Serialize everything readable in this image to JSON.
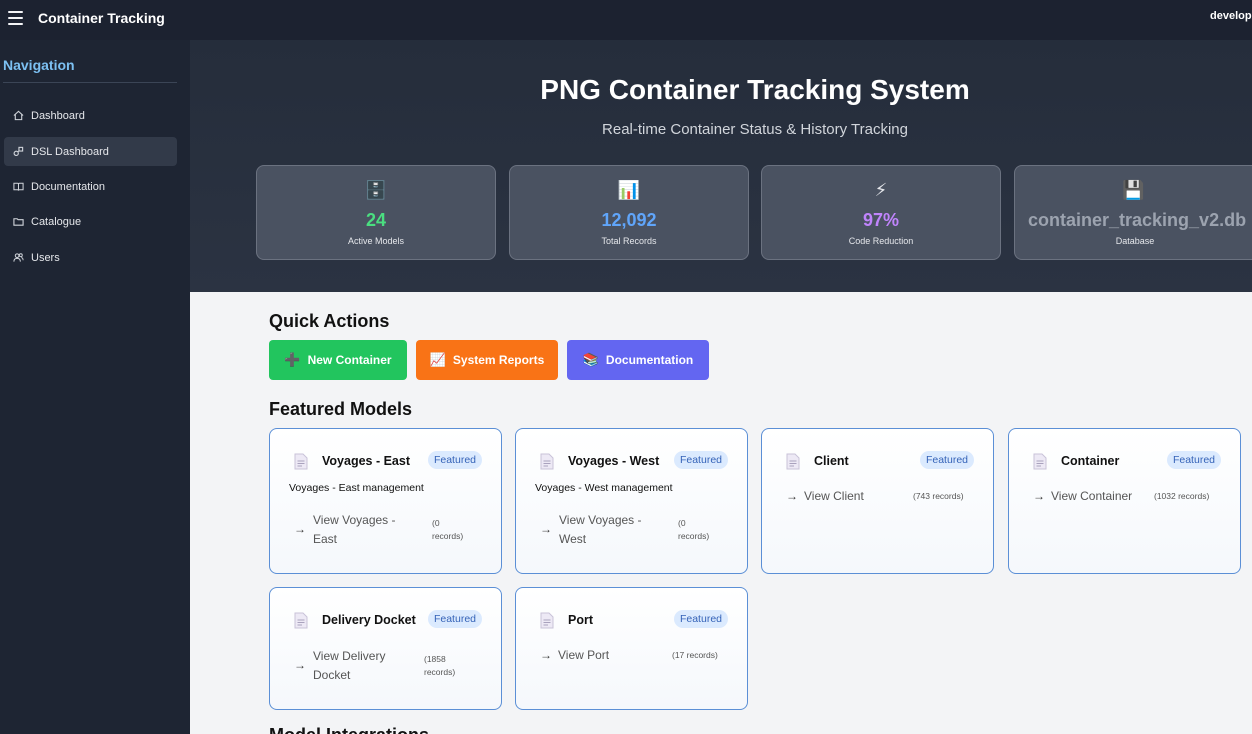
{
  "app": {
    "title": "Container Tracking",
    "user": "developer"
  },
  "sidebar": {
    "heading": "Navigation",
    "items": [
      {
        "label": "Dashboard",
        "icon": "home-icon",
        "active": false
      },
      {
        "label": "DSL Dashboard",
        "icon": "dsl-icon",
        "active": true
      },
      {
        "label": "Documentation",
        "icon": "book-icon",
        "active": false
      },
      {
        "label": "Catalogue",
        "icon": "folder-icon",
        "active": false
      },
      {
        "label": "Users",
        "icon": "users-icon",
        "active": false
      }
    ]
  },
  "hero": {
    "title": "PNG Container Tracking System",
    "subtitle": "Real-time Container Status & History Tracking",
    "stats": [
      {
        "icon": "🗄️",
        "value": "24",
        "label": "Active Models",
        "color": "#4ade80"
      },
      {
        "icon": "📊",
        "value": "12,092",
        "label": "Total Records",
        "color": "#60a5fa"
      },
      {
        "icon": "⚡",
        "value": "97%",
        "label": "Code Reduction",
        "color": "#c084fc"
      },
      {
        "icon": "💾",
        "value": "container_tracking_v2.db",
        "label": "Database",
        "color": "#9ca3af"
      }
    ]
  },
  "quick_actions": {
    "title": "Quick Actions",
    "buttons": [
      {
        "label": "New Container",
        "icon": "➕",
        "color": "#22c55e"
      },
      {
        "label": "System Reports",
        "icon": "📈",
        "color": "#f97316"
      },
      {
        "label": "Documentation",
        "icon": "📚",
        "color": "#6366f1"
      }
    ]
  },
  "featured": {
    "title": "Featured Models",
    "next_section_title": "Model Integrations",
    "cards": [
      {
        "title": "Voyages - East",
        "badge": "Featured",
        "description": "Voyages - East management",
        "link_lines": [
          "View Voyages -",
          "East"
        ],
        "count_lines": [
          "(0",
          "records)"
        ]
      },
      {
        "title": "Voyages - West",
        "badge": "Featured",
        "description": "Voyages - West management",
        "link_lines": [
          "View Voyages -",
          "West"
        ],
        "count_lines": [
          "(0",
          "records)"
        ]
      },
      {
        "title": "Client",
        "badge": "Featured",
        "description": "",
        "link_lines": [
          "View Client"
        ],
        "count_lines": [
          "(743 records)"
        ]
      },
      {
        "title": "Container",
        "badge": "Featured",
        "description": "",
        "link_lines": [
          "View Container"
        ],
        "count_lines": [
          "(1032 records)"
        ]
      },
      {
        "title": "Delivery Docket",
        "badge": "Featured",
        "description": "",
        "link_lines": [
          "View Delivery",
          "Docket"
        ],
        "count_lines": [
          "(1858",
          "records)"
        ]
      },
      {
        "title": "Port",
        "badge": "Featured",
        "description": "",
        "link_lines": [
          "View Port"
        ],
        "count_lines": [
          "(17 records)"
        ]
      }
    ]
  }
}
